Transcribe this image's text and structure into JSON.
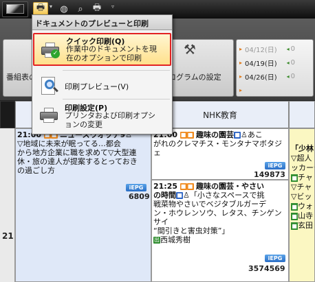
{
  "ribbon": {
    "left_group_label": "番組表の",
    "mid_group_label": "ログラムの設定",
    "dates": [
      {
        "label": "04/12(日)",
        "faded": true
      },
      {
        "label": "04/19(日)",
        "faded": false
      },
      {
        "label": "04/26(日)",
        "faded": false
      },
      {
        "label": "",
        "faded": true
      }
    ],
    "date_tail_arrow": "◂",
    "date_tail_text": "0"
  },
  "menu": {
    "header": "ドキュメントのプレビューと印刷",
    "quick": {
      "title": "クイック印刷(Q)",
      "desc1": "作業中のドキュメントを現",
      "desc2": "在のオプションで印刷"
    },
    "preview": {
      "title": "印刷プレビュー(V)"
    },
    "settings": {
      "title": "印刷設定(P)",
      "desc1": "プリンタおよび印刷オプシ",
      "desc2": "ョンの変更"
    }
  },
  "grid": {
    "channel_b": "NHK教育",
    "hour": "21",
    "blue_cell": {
      "time": "21:00",
      "title": "ニュースウオッチ9",
      "body": [
        "▽地域に未来が眠ってる…都会",
        "から地方企業に職を求めて▽大型連",
        "休・旅の達人が提案するとっておき",
        "の過ごし方"
      ],
      "badge": "iEPG",
      "count": "6809"
    },
    "white_cell_1": {
      "time": "21:00",
      "title": "趣味の園芸",
      "suffix": "あこ",
      "body": [
        "がれのクレマチス・モンタナマボタジ",
        "ェ"
      ],
      "badge": "iEPG",
      "count": "149873"
    },
    "white_cell_2": {
      "time": "21:25",
      "title": "趣味の園芸・やさい",
      "title2": "の時間",
      "lead": "「小さなスペースで挑",
      "body": [
        "戦菜物やさいでベジタブルガーデ",
        "ン・ホウレンソウ、レタス、チンゲンサイ",
        "“間引きと害虫対策”」"
      ],
      "cast_icon": "出",
      "cast": "西城秀樹",
      "badge": "iEPG",
      "count": "3574569"
    },
    "right_strip": {
      "title": "「少林",
      "lines": [
        "▽超人",
        "ッカー化",
        "チャ",
        "▽チャ",
        "▽ビッ",
        "ウォ",
        "山寺",
        "玄田"
      ]
    }
  },
  "icons": {
    "print": "printer-icon",
    "globe": "globe-icon",
    "preview_small": "magnifier-icon",
    "print_setup_small": "printer-setup-icon",
    "more": "chevron-down-icon",
    "tools": "tools-icon"
  },
  "colors": {
    "highlight_border": "#e22222",
    "iepg_blue": "#2b6fc6"
  }
}
